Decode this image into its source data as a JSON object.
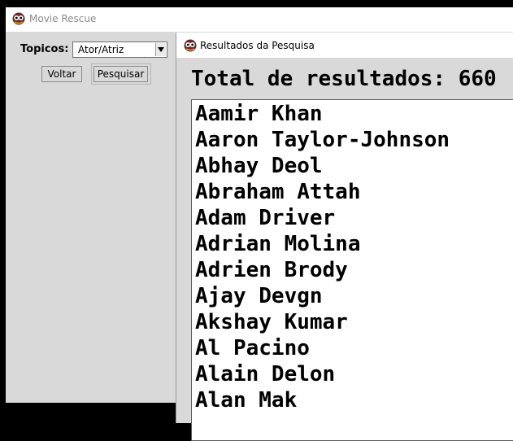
{
  "main_window": {
    "title": "Movie Rescue",
    "topicos_label": "Topicos:",
    "topicos_selected": "Ator/Atriz",
    "voltar_label": "Voltar",
    "pesquisar_label": "Pesquisar"
  },
  "results_window": {
    "title": "Resultados da Pesquisa",
    "total_label": "Total de resultados: 660",
    "items": [
      "Aamir Khan",
      "Aaron Taylor-Johnson",
      "Abhay Deol",
      "Abraham Attah",
      "Adam Driver",
      "Adrian Molina",
      "Adrien Brody",
      "Ajay Devgn",
      "Akshay Kumar",
      "Al Pacino",
      "Alain Delon",
      "Alan Mak"
    ]
  },
  "icons": {
    "app_icon": "owl-app-icon",
    "dropdown_icon": "chevron-down-icon"
  },
  "colors": {
    "window_bg": "#d9d9d9",
    "titlebar_bg": "#ffffff",
    "desktop_bg": "#000000"
  }
}
